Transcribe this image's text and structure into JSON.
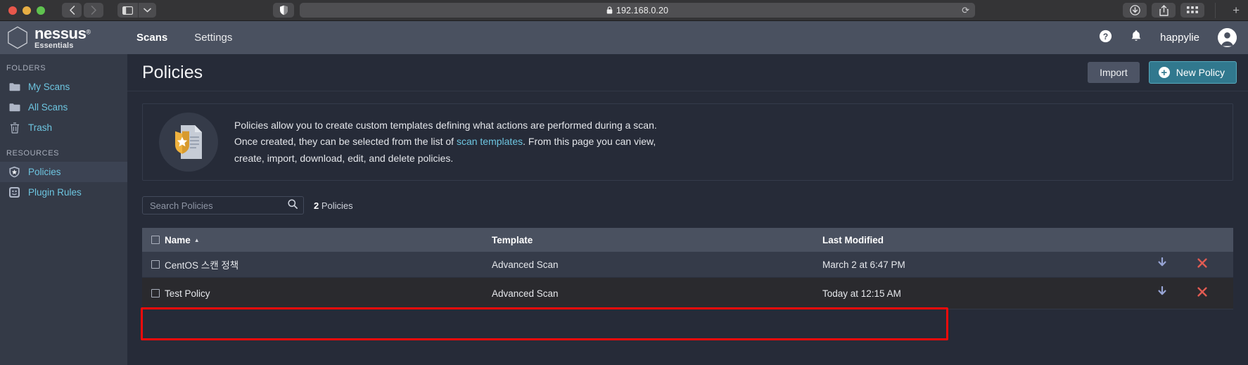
{
  "browser": {
    "traffic_lights": [
      "close",
      "minimize",
      "maximize"
    ],
    "back_label": "‹",
    "forward_label": "›",
    "sidebar_toggle": "sidebar-icon",
    "sidebar_chevron": "⌄",
    "shield_icon": "privacy-shield-icon",
    "address": "192.168.0.20",
    "lock_icon": "lock-icon",
    "reload_icon": "⟳",
    "downloads_icon": "downloads-icon",
    "share_icon": "share-icon",
    "tabs_overview_icon": "tab-overview-icon",
    "new_tab_label": "+"
  },
  "topnav": {
    "brand_name": "nessus",
    "brand_registered": "®",
    "brand_sub": "Essentials",
    "links": [
      {
        "label": "Scans",
        "active": true
      },
      {
        "label": "Settings",
        "active": false
      }
    ],
    "help_icon": "help-circle-icon",
    "notifications_icon": "bell-icon",
    "username": "happylie",
    "avatar_icon": "user-avatar-icon"
  },
  "sidebar": {
    "folders_label": "FOLDERS",
    "resources_label": "RESOURCES",
    "folders": [
      {
        "label": "My Scans",
        "icon": "folder-icon",
        "selected": false
      },
      {
        "label": "All Scans",
        "icon": "folder-icon",
        "selected": false
      },
      {
        "label": "Trash",
        "icon": "trash-icon",
        "selected": false
      }
    ],
    "resources": [
      {
        "label": "Policies",
        "icon": "policy-shield-icon",
        "selected": true
      },
      {
        "label": "Plugin Rules",
        "icon": "plugin-rules-icon",
        "selected": false
      }
    ]
  },
  "page": {
    "title": "Policies",
    "import_label": "Import",
    "new_policy_label": "New Policy",
    "new_policy_icon": "plus-circle-icon"
  },
  "info": {
    "icon": "policy-document-icon",
    "line1_a": "Policies allow you to create custom templates defining what actions are performed during a scan.",
    "line2_a": "Once created, they can be selected from the list of ",
    "line2_link": "scan templates",
    "line2_b": ". From this page you can view,",
    "line3": "create, import, download, edit, and delete policies."
  },
  "search": {
    "placeholder": "Search Policies",
    "value": "",
    "icon": "search-icon",
    "count_number": "2",
    "count_label": " Policies"
  },
  "table": {
    "columns": [
      {
        "key": "name",
        "label": "Name",
        "sorted": "asc",
        "sort_caret": "▲"
      },
      {
        "key": "template",
        "label": "Template",
        "sorted": null
      },
      {
        "key": "modified",
        "label": "Last Modified",
        "sorted": null
      }
    ],
    "select_all_checked": false,
    "rows": [
      {
        "checked": false,
        "name": "CentOS 스캔 정책",
        "template": "Advanced Scan",
        "modified": "March 2 at 6:47 PM",
        "download_icon": "download-arrow-icon",
        "delete_icon": "delete-x-icon",
        "highlighted": false
      },
      {
        "checked": false,
        "name": "Test Policy",
        "template": "Advanced Scan",
        "modified": "Today at 12:15 AM",
        "download_icon": "download-arrow-icon",
        "delete_icon": "delete-x-icon",
        "highlighted": true
      }
    ]
  },
  "annotation": {
    "highlight_color": "#f20b0b",
    "target_row": "Test Policy"
  },
  "colors": {
    "accent_teal": "#31788e",
    "link_blue": "#6dc5e0",
    "topnav_bg": "#4a5160",
    "sidebar_bg": "#343a47",
    "main_bg": "#262b38",
    "danger_red": "#e15b52"
  }
}
